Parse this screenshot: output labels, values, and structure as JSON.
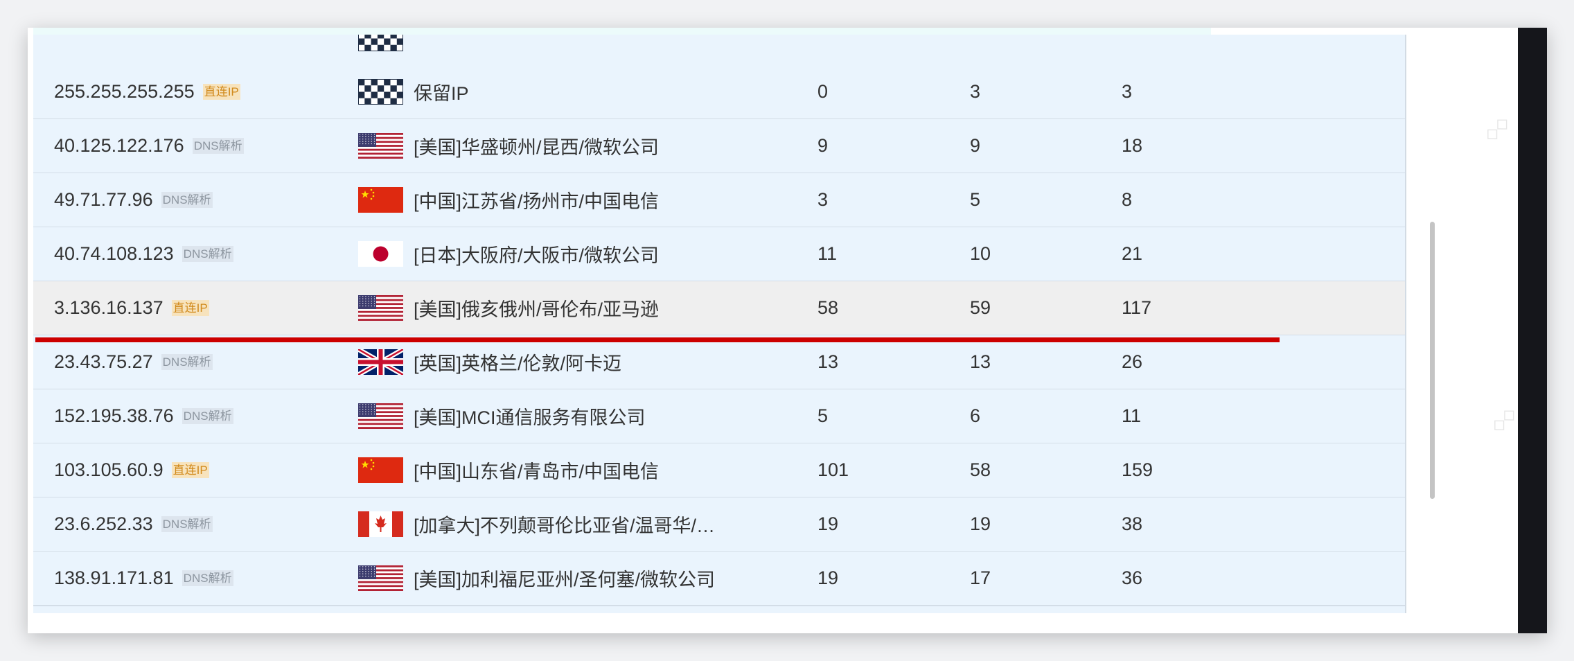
{
  "table": {
    "rows": [
      {
        "ip": "255.255.255.255",
        "tag": "直连IP",
        "tag_type": "direct",
        "flag": "reserved-checkered-flag",
        "location": "保留IP",
        "v1": "0",
        "v2": "3",
        "v3": "3"
      },
      {
        "ip": "40.125.122.176",
        "tag": "DNS解析",
        "tag_type": "dns",
        "flag": "us-flag",
        "location": "[美国]华盛顿州/昆西/微软公司",
        "v1": "9",
        "v2": "9",
        "v3": "18"
      },
      {
        "ip": "49.71.77.96",
        "tag": "DNS解析",
        "tag_type": "dns",
        "flag": "cn-flag",
        "location": "[中国]江苏省/扬州市/中国电信",
        "v1": "3",
        "v2": "5",
        "v3": "8"
      },
      {
        "ip": "40.74.108.123",
        "tag": "DNS解析",
        "tag_type": "dns",
        "flag": "jp-flag",
        "location": "[日本]大阪府/大阪市/微软公司",
        "v1": "11",
        "v2": "10",
        "v3": "21"
      },
      {
        "ip": "3.136.16.137",
        "tag": "直连IP",
        "tag_type": "direct",
        "flag": "us-flag",
        "location": "[美国]俄亥俄州/哥伦布/亚马逊",
        "v1": "58",
        "v2": "59",
        "v3": "117",
        "highlighted": true
      },
      {
        "ip": "23.43.75.27",
        "tag": "DNS解析",
        "tag_type": "dns",
        "flag": "uk-flag",
        "location": "[英国]英格兰/伦敦/阿卡迈",
        "v1": "13",
        "v2": "13",
        "v3": "26"
      },
      {
        "ip": "152.195.38.76",
        "tag": "DNS解析",
        "tag_type": "dns",
        "flag": "us-flag",
        "location": "[美国]MCI通信服务有限公司",
        "v1": "5",
        "v2": "6",
        "v3": "11"
      },
      {
        "ip": "103.105.60.9",
        "tag": "直连IP",
        "tag_type": "direct",
        "flag": "cn-flag",
        "location": "[中国]山东省/青岛市/中国电信",
        "v1": "101",
        "v2": "58",
        "v3": "159"
      },
      {
        "ip": "23.6.252.33",
        "tag": "DNS解析",
        "tag_type": "dns",
        "flag": "ca-flag",
        "location": "[加拿大]不列颠哥伦比亚省/温哥华/…",
        "v1": "19",
        "v2": "19",
        "v3": "38"
      },
      {
        "ip": "138.91.171.81",
        "tag": "DNS解析",
        "tag_type": "dns",
        "flag": "us-flag",
        "location": "[美国]加利福尼亚州/圣何塞/微软公司",
        "v1": "19",
        "v2": "17",
        "v3": "36"
      }
    ]
  },
  "colors": {
    "row_bg": "#eaf4fd",
    "highlight_bg": "#efefef",
    "underline": "#cc0000",
    "direct_tag_bg": "#f7e3bd",
    "direct_tag_text": "#d18a1c",
    "dns_tag_bg": "#dde5ee",
    "dns_tag_text": "#8d96a0"
  }
}
